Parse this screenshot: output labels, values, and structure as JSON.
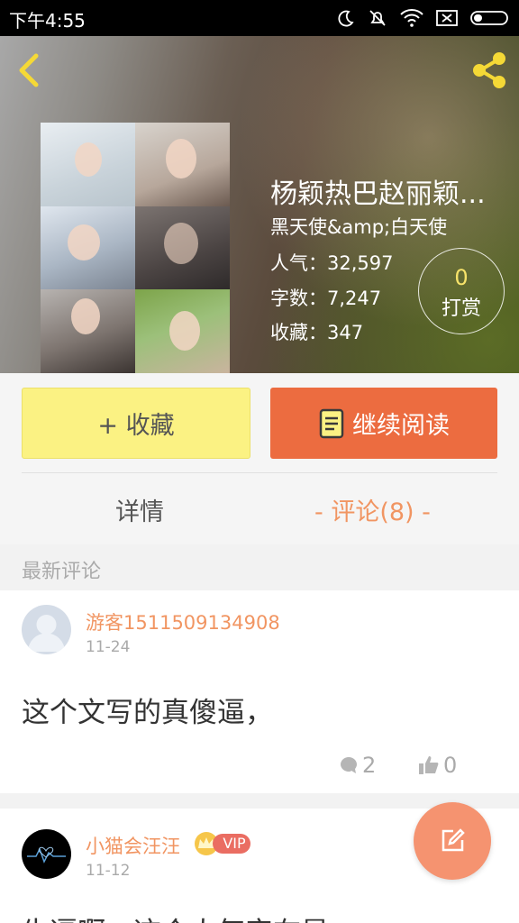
{
  "status_bar": {
    "time": "下午4:55"
  },
  "book": {
    "title": "杨颖热巴赵丽颖...",
    "author": "黑天使&amp;白天使",
    "popularity": "人气：32,597",
    "word_count": "字数：7,247",
    "favorites": "收藏：347"
  },
  "tip": {
    "count": "0",
    "label": "打赏"
  },
  "actions": {
    "favorite_label": "+ 收藏",
    "continue_label": "继续阅读"
  },
  "tabs": {
    "detail": "详情",
    "comments": "- 评论(8) -"
  },
  "comments_section": {
    "title": "最新评论",
    "items": [
      {
        "user": "游客1511509134908",
        "date": "11-24",
        "text": "这个文写的真傻逼，",
        "replies": "2",
        "likes": "0"
      },
      {
        "user": "小猫会汪汪",
        "badge": "VIP",
        "date": "11-12",
        "text": "牛逼啊，这个人气实在是"
      }
    ]
  },
  "colors": {
    "accent": "#f19562",
    "read_button": "#ec6c40",
    "favorite_button": "#fbf283",
    "fab": "#f59370",
    "header_icons": "#f5d936"
  },
  "icons": [
    "back-chevron-icon",
    "share-icon",
    "book-icon",
    "comment-icon",
    "thumbs-up-icon",
    "edit-icon",
    "crown-icon",
    "moon-icon",
    "mute-icon",
    "wifi-icon",
    "sim-icon",
    "battery-icon"
  ]
}
